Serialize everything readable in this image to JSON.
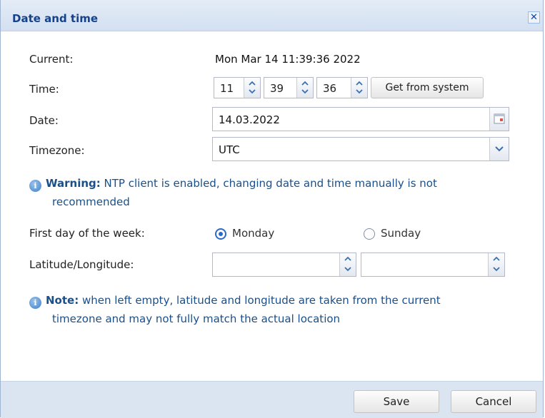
{
  "dialog": {
    "title": "Date and time",
    "close_symbol": "✕"
  },
  "current": {
    "label": "Current:",
    "value": "Mon Mar 14 11:39:36 2022"
  },
  "time": {
    "label": "Time:",
    "hours": "11",
    "minutes": "39",
    "seconds": "36",
    "get_from_system_label": "Get from system"
  },
  "date": {
    "label": "Date:",
    "value": "14.03.2022"
  },
  "timezone": {
    "label": "Timezone:",
    "value": "UTC"
  },
  "warning": {
    "title": "Warning:",
    "text": "NTP client is enabled, changing date and time manually is not",
    "text_line2": "recommended"
  },
  "first_day": {
    "label": "First day of the week:",
    "options": [
      {
        "label": "Monday",
        "checked": true
      },
      {
        "label": "Sunday",
        "checked": false
      }
    ]
  },
  "latlong": {
    "label": "Latitude/Longitude:",
    "latitude": "",
    "longitude": ""
  },
  "note": {
    "title": "Note:",
    "text": "when left empty, latitude and longitude are taken from the current",
    "text_line2": "timezone and may not fully match the actual location"
  },
  "footer": {
    "save_label": "Save",
    "cancel_label": "Cancel"
  },
  "colors": {
    "title": "#15428b",
    "info_text": "#1a4f8a",
    "accent": "#2a6bc9",
    "footer_bg": "#dbe5f2"
  },
  "icons": {
    "info": "info-icon",
    "calendar": "calendar-icon",
    "dropdown": "chevron-down-icon",
    "spinner": "spinner-arrows-icon",
    "close": "close-icon"
  }
}
